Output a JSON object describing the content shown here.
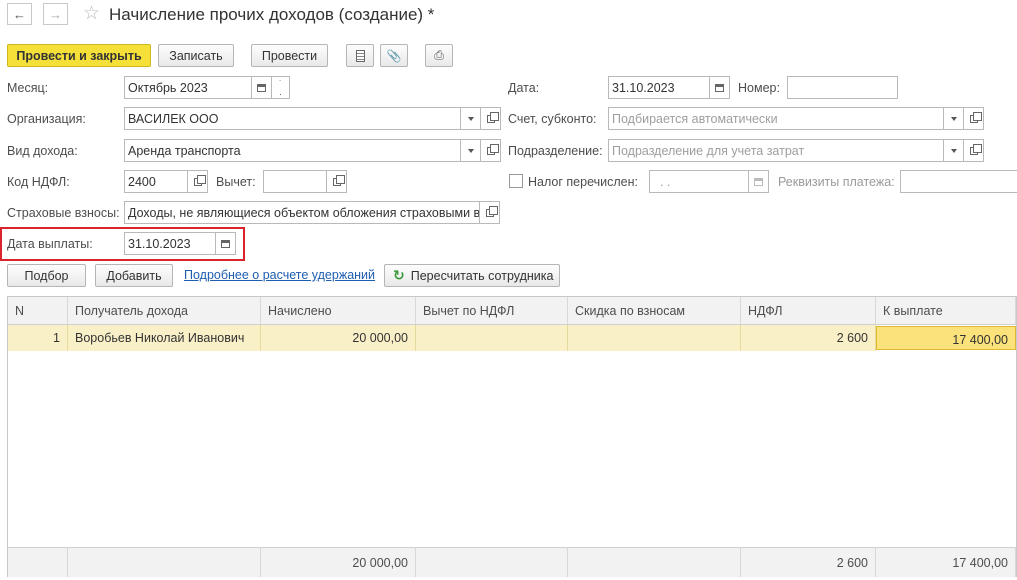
{
  "window": {
    "title": "Начисление прочих доходов (создание) *",
    "back_icon": "arrow-left-icon",
    "forward_icon": "arrow-right-icon",
    "favorite_icon": "star-icon"
  },
  "toolbar": {
    "post_and_close": "Провести и закрыть",
    "save": "Записать",
    "post": "Провести",
    "accent_color": "#f5e03a"
  },
  "form": {
    "month_label": "Месяц:",
    "month_value": "Октябрь 2023",
    "date_label": "Дата:",
    "date_value": "31.10.2023",
    "number_label": "Номер:",
    "number_value": "",
    "org_label": "Организация:",
    "org_value": "ВАСИЛЕК ООО",
    "account_label": "Счет, субконто:",
    "account_placeholder": "Подбирается автоматически",
    "income_type_label": "Вид дохода:",
    "income_type_value": "Аренда транспорта",
    "division_label": "Подразделение:",
    "division_placeholder": "Подразделение для учета затрат",
    "ndfl_code_label": "Код НДФЛ:",
    "ndfl_code_value": "2400",
    "deduction_label": "Вычет:",
    "deduction_value": "",
    "tax_transferred_label": "Налог перечислен:",
    "tax_transferred_date": ". .",
    "payment_details_label": "Реквизиты платежа:",
    "insurance_label": "Страховые взносы:",
    "insurance_value": "Доходы, не являющиеся объектом обложения страховыми вз",
    "payment_date_label": "Дата выплаты:",
    "payment_date_value": "31.10.2023",
    "highlight_color": "#d9232d"
  },
  "table_toolbar": {
    "select": "Подбор",
    "add": "Добавить",
    "details_link": "Подробнее о расчете удержаний",
    "recalc": "Пересчитать сотрудника"
  },
  "table": {
    "columns": [
      "N",
      "Получатель дохода",
      "Начислено",
      "Вычет по НДФЛ",
      "Скидка по взносам",
      "НДФЛ",
      "К выплате"
    ],
    "rows": [
      {
        "n": "1",
        "recipient": "Воробьев Николай Иванович",
        "accrued": "20 000,00",
        "deduction": "",
        "discount": "",
        "ndfl": "2 600",
        "payout": "17 400,00"
      }
    ],
    "totals": {
      "accrued": "20 000,00",
      "ndfl": "2 600",
      "payout": "17 400,00"
    },
    "selected_row_color": "#faf0c8"
  }
}
